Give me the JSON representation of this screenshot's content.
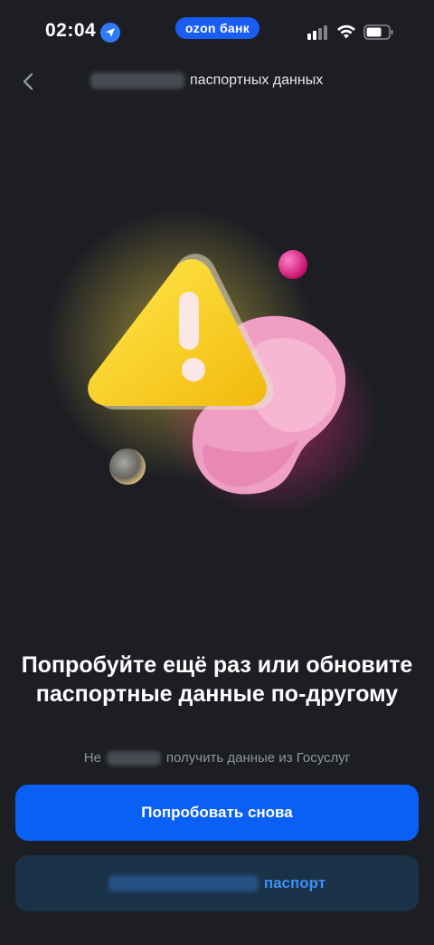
{
  "status_bar": {
    "time": "02:04",
    "brand": "ozon банк"
  },
  "nav": {
    "title_visible": "паспортных данных"
  },
  "content": {
    "headline": "Попробуйте ещё раз или обновите паспортные данные по-другому",
    "subtitle_prefix": "Не",
    "subtitle_suffix": "получить данные из Госуслуг"
  },
  "actions": {
    "primary_label": "Попробовать снова",
    "secondary_label_visible": "паспорт"
  },
  "colors": {
    "background": "#1c1e24",
    "primary": "#0a5ff5",
    "secondary_bg": "#1a3248",
    "secondary_text": "#3d8ff5",
    "warning_yellow": "#f7d21a",
    "pink": "#f2a3c8"
  }
}
